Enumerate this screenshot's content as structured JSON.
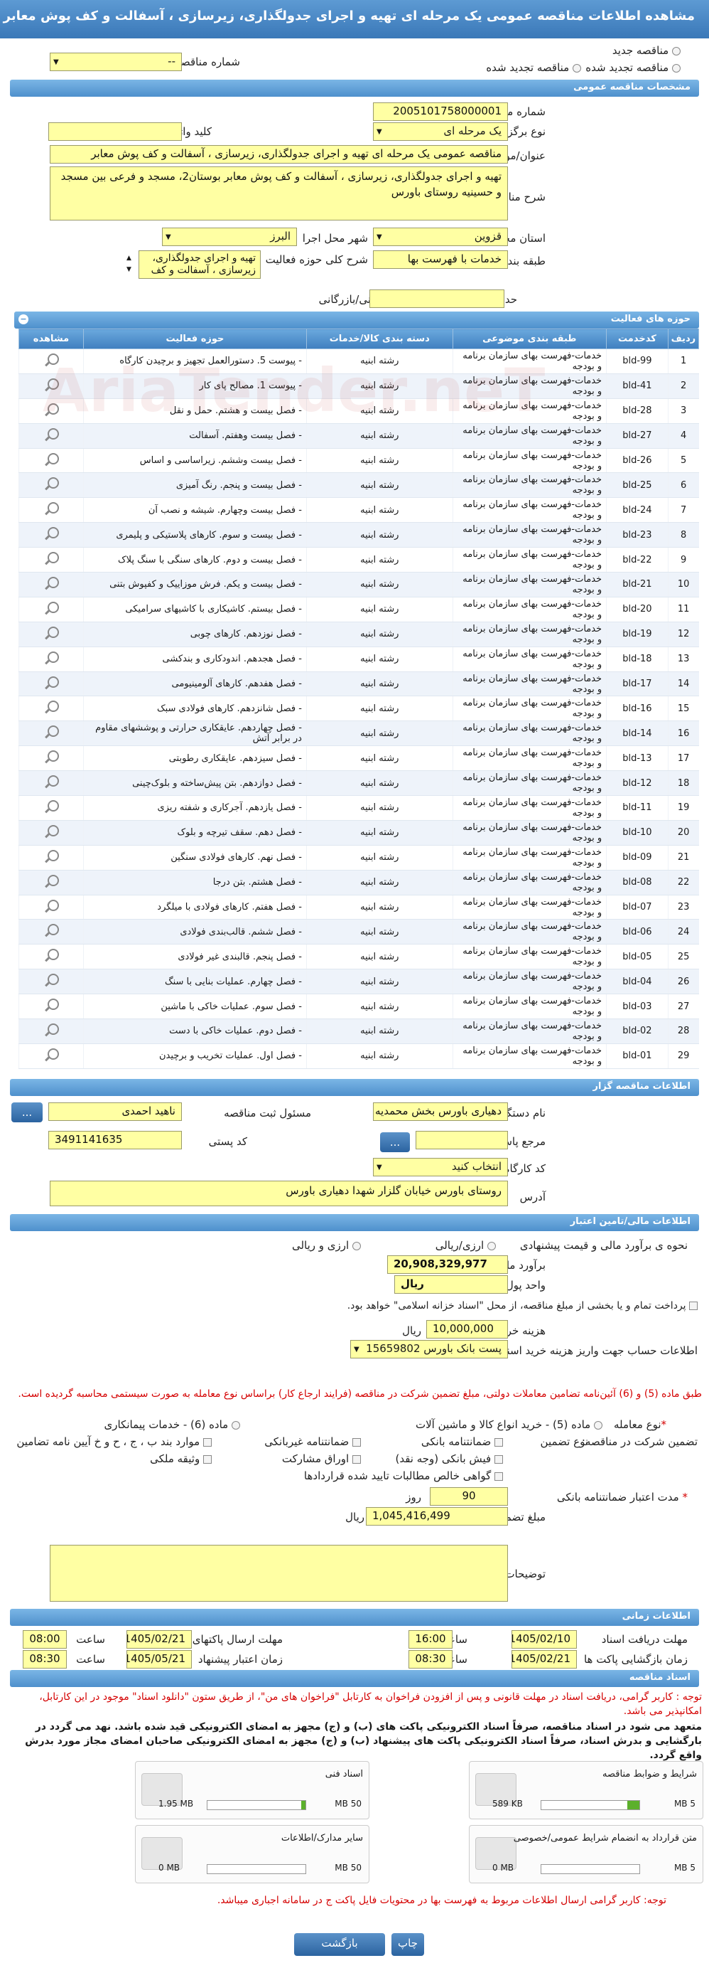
{
  "page_title": "مشاهده اطلاعات مناقصه عمومی یک مرحله ای تهیه و اجرای جدولگذاری، زیرسازی ، آسفالت و کف پوش معابر",
  "top": {
    "new_label": "مناقصه جدید",
    "renewed_label": "مناقصه تجدید شده",
    "renewed2_label": "مناقصه تجدید شده",
    "prev_label": "شماره مناقصه قبلی",
    "prev_value": "--"
  },
  "sections": {
    "general": "مشخصات مناقصه عمومی",
    "activities": "حوزه های فعالیت",
    "organizer": "اطلاعات مناقصه گزار",
    "financial": "اطلاعات مالی/تامین اعتبار",
    "timing": "اطلاعات زمانی",
    "documents": "اسناد مناقصه"
  },
  "general": {
    "tender_no_label": "شماره مناقصه",
    "tender_no": "2005101758000001",
    "type_label": "نوع برگزاری",
    "type": "یک مرحله ای",
    "keyword_label": "کلید واژه",
    "keyword": "",
    "subject_label": "عنوان/موضوع مناقصه",
    "subject": "مناقصه عمومی یک مرحله ای تهیه و اجرای جدولگذاری، زیرسازی ، آسفالت و کف پوش معابر",
    "desc_label": "شرح مناقصه",
    "desc": "تهیه و اجرای جدولگذاری، زیرسازی ، آسفالت و کف پوش معابر بوستان2، مسجد و فرعی بین مسجد و حسینیه روستای باورس",
    "province_label": "استان محل اجرا",
    "province": "قزوین",
    "city_label": "شهر محل اجرا",
    "city": "البرز",
    "category_label": "طبقه بندی موضوعی",
    "category": "خدمات با فهرست بها",
    "activity_label": "شرح کلی حوزه فعالیت",
    "activity": "تهیه و اجرای جدولگذاری، زیرسازی ، آسفالت و کف",
    "min_score_label": "حداقل امتیاز قابل قبول ارزیابی فنی/بازرگانی",
    "min_score": ""
  },
  "grid": {
    "title": "حوزه های فعالیت",
    "headers": [
      "ردیف",
      "کدخدمت",
      "طبقه بندی موضوعی",
      "دسته بندی کالا/خدمات",
      "حوزه فعالیت",
      "مشاهده"
    ],
    "rows": [
      [
        "1",
        "bld-99",
        "خدمات-فهرست بهای سازمان برنامه و بودجه",
        "رشته ابنیه",
        "- پیوست 5. دستورالعمل تجهیز و برچیدن کارگاه"
      ],
      [
        "2",
        "bld-41",
        "خدمات-فهرست بهای سازمان برنامه و بودجه",
        "رشته ابنیه",
        "- پیوست 1. مصالح پای کار"
      ],
      [
        "3",
        "bld-28",
        "خدمات-فهرست بهای سازمان برنامه و بودجه",
        "رشته ابنیه",
        "- فصل بیست و هشتم. حمل و نقل"
      ],
      [
        "4",
        "bld-27",
        "خدمات-فهرست بهای سازمان برنامه و بودجه",
        "رشته ابنیه",
        "- فصل بیست وهفتم. آسفالت"
      ],
      [
        "5",
        "bld-26",
        "خدمات-فهرست بهای سازمان برنامه و بودجه",
        "رشته ابنیه",
        "- فصل بیست وششم. زیراساسی و اساس"
      ],
      [
        "6",
        "bld-25",
        "خدمات-فهرست بهای سازمان برنامه و بودجه",
        "رشته ابنیه",
        "- فصل بیست و پنجم. رنگ آمیزی"
      ],
      [
        "7",
        "bld-24",
        "خدمات-فهرست بهای سازمان برنامه و بودجه",
        "رشته ابنیه",
        "- فصل بیست وچهارم. شیشه و نصب آن"
      ],
      [
        "8",
        "bld-23",
        "خدمات-فهرست بهای سازمان برنامه و بودجه",
        "رشته ابنیه",
        "- فصل بیست و سوم. کارهای پلاستیکی و پلیمری"
      ],
      [
        "9",
        "bld-22",
        "خدمات-فهرست بهای سازمان برنامه و بودجه",
        "رشته ابنیه",
        "- فصل بیست و دوم. کارهای سنگی با سنگ پلاک"
      ],
      [
        "10",
        "bld-21",
        "خدمات-فهرست بهای سازمان برنامه و بودجه",
        "رشته ابنیه",
        "- فصل بیست و یکم. فرش موزاییک و کفپوش بتنی"
      ],
      [
        "11",
        "bld-20",
        "خدمات-فهرست بهای سازمان برنامه و بودجه",
        "رشته ابنیه",
        "- فصل بیستم. کاشیکاری با کاشیهای سرامیکی"
      ],
      [
        "12",
        "bld-19",
        "خدمات-فهرست بهای سازمان برنامه و بودجه",
        "رشته ابنیه",
        "- فصل نوزدهم. کارهای چوبی"
      ],
      [
        "13",
        "bld-18",
        "خدمات-فهرست بهای سازمان برنامه و بودجه",
        "رشته ابنیه",
        "- فصل هجدهم. اندودکاری و بندکشی"
      ],
      [
        "14",
        "bld-17",
        "خدمات-فهرست بهای سازمان برنامه و بودجه",
        "رشته ابنیه",
        "- فصل هفدهم. کارهای آلومینیومی"
      ],
      [
        "15",
        "bld-16",
        "خدمات-فهرست بهای سازمان برنامه و بودجه",
        "رشته ابنیه",
        "- فصل شانزدهم. کارهای فولادی سبک"
      ],
      [
        "16",
        "bld-14",
        "خدمات-فهرست بهای سازمان برنامه و بودجه",
        "رشته ابنیه",
        "- فصل چهاردهم. عایقکاری حرارتی و پوششهای مقاوم در برابر آتش"
      ],
      [
        "17",
        "bld-13",
        "خدمات-فهرست بهای سازمان برنامه و بودجه",
        "رشته ابنیه",
        "- فصل سیزدهم. عایقکاری رطوبتی"
      ],
      [
        "18",
        "bld-12",
        "خدمات-فهرست بهای سازمان برنامه و بودجه",
        "رشته ابنیه",
        "- فصل دوازدهم. بتن پیش‌ساخته و بلوک‌چینی"
      ],
      [
        "19",
        "bld-11",
        "خدمات-فهرست بهای سازمان برنامه و بودجه",
        "رشته ابنیه",
        "- فصل یازدهم. آجرکاری و شفته ریزی"
      ],
      [
        "20",
        "bld-10",
        "خدمات-فهرست بهای سازمان برنامه و بودجه",
        "رشته ابنیه",
        "- فصل دهم. سقف تیرچه و بلوک"
      ],
      [
        "21",
        "bld-09",
        "خدمات-فهرست بهای سازمان برنامه و بودجه",
        "رشته ابنیه",
        "- فصل نهم. کارهای فولادی سنگین"
      ],
      [
        "22",
        "bld-08",
        "خدمات-فهرست بهای سازمان برنامه و بودجه",
        "رشته ابنیه",
        "- فصل هشتم. بتن درجا"
      ],
      [
        "23",
        "bld-07",
        "خدمات-فهرست بهای سازمان برنامه و بودجه",
        "رشته ابنیه",
        "- فصل هفتم. کارهای فولادی با میلگرد"
      ],
      [
        "24",
        "bld-06",
        "خدمات-فهرست بهای سازمان برنامه و بودجه",
        "رشته ابنیه",
        "- فصل ششم. قالب‌بندی فولادی"
      ],
      [
        "25",
        "bld-05",
        "خدمات-فهرست بهای سازمان برنامه و بودجه",
        "رشته ابنیه",
        "- فصل پنجم. قالبندی غیر فولادی"
      ],
      [
        "26",
        "bld-04",
        "خدمات-فهرست بهای سازمان برنامه و بودجه",
        "رشته ابنیه",
        "- فصل چهارم. عملیات بنایی با سنگ"
      ],
      [
        "27",
        "bld-03",
        "خدمات-فهرست بهای سازمان برنامه و بودجه",
        "رشته ابنیه",
        "- فصل سوم. عملیات خاکی با ماشین"
      ],
      [
        "28",
        "bld-02",
        "خدمات-فهرست بهای سازمان برنامه و بودجه",
        "رشته ابنیه",
        "- فصل دوم. عملیات خاکی با دست"
      ],
      [
        "29",
        "bld-01",
        "خدمات-فهرست بهای سازمان برنامه و بودجه",
        "رشته ابنیه",
        "- فصل اول. عملیات تخریب و برچیدن"
      ]
    ]
  },
  "organizer": {
    "org_label": "نام دستگاه اجرایی مناقصه گزار",
    "org": "دهیاری باورس بخش محمدیه",
    "resp_label": "مسئول ثبت مناقصه",
    "resp": "ناهید احمدی",
    "ref_label": "مرجع پاسخگویی",
    "ref": "",
    "postal_label": "کد پستی",
    "postal": "3491141635",
    "workshop_label": "کد کارگاه مناقصه گزار",
    "workshop": "انتخاب کنید",
    "address_label": "آدرس",
    "address": "روستای باورس خیابان گلزار شهدا دهیاری باورس",
    "more": "...",
    "more2": "..."
  },
  "financial": {
    "estimate_label": "نحوه ی برآورد مالی و قیمت پیشنهادی",
    "opt_rial": "ارزی/ریالی",
    "opt_both": "ارزی و ریالی",
    "estimate_amount_label": "برآورد مالی",
    "estimate_amount": "20,908,329,977",
    "currency_label": "واحد پول",
    "currency": "ریال",
    "payment_text": "پرداخت تمام و یا بخشی از مبلغ مناقصه، از محل \"اسناد خزانه اسلامی\" خواهد بود.",
    "doc_fee_label": "هزینه خرید اسناد",
    "doc_fee": "10,000,000",
    "rial": "ریال",
    "account_label": "اطلاعات حساب جهت واریز هزینه خرید اسناد",
    "account": "پست بانک باورس 15659802",
    "article_note": "طبق ماده (5) و (6) آئین‌نامه تضامین معاملات دولتی، مبلغ تضمین شرکت در مناقصه (فرایند ارجاع کار) براساس نوع معامله به صورت سیستمی محاسبه گردیده است.",
    "deal_type_label": "نوع معامله",
    "deal5": "ماده (5) - خرید انواع کالا و ماشین آلات",
    "deal6": "ماده (6) - خدمات پیمانکاری",
    "guarantee_label": "تضمین شرکت در مناقصه:",
    "guarantee_type_label": "نوع تضمین",
    "g1": "ضمانتنامه بانکی",
    "g2": "ضمانتنامه غیربانکی",
    "g3": "موارد بند ب ، ج ، ح و خ آیین نامه تضامین",
    "g4": "فیش بانکی (وجه نقد)",
    "g5": "اوراق مشارکت",
    "g6": "وثیقه ملکی",
    "g7": "گواهی خالص مطالبات تایید شده قراردادها",
    "validity_label": "مدت اعتبار ضمانتنامه بانکی",
    "validity": "90",
    "day": "روز",
    "guarantee_amount_label": "مبلغ تضمین",
    "guarantee_amount": "1,045,416,499",
    "notes_label": "توضیحات"
  },
  "timing": {
    "doc_receive_label": "مهلت دریافت اسناد",
    "doc_receive_date": "1405/02/10",
    "doc_receive_time": "16:00",
    "time_label": "ساعت",
    "send_label": "مهلت ارسال پاکتهای پیشنهاد",
    "send_date": "1405/02/21",
    "send_time": "08:00",
    "open_label": "زمان بازگشایی پاکت ها",
    "open_date": "1405/02/21",
    "open_time": "08:30",
    "validity_label": "زمان اعتبار پیشنهاد",
    "validity_date": "1405/05/21",
    "validity_time": "08:30"
  },
  "documents": {
    "note1": "توجه : کاربر گرامی، دریافت اسناد در مهلت قانونی و پس از افزودن فراخوان به کارتابل \"فراخوان های من\"، از طریق ستون \"دانلود اسناد\" موجود در این کارتابل، امکانپذیر می باشد.",
    "note2": "متعهد می شود در اسناد مناقصه، صرفاً اسناد الکترونیکی پاکت های (ب) و (ج) مجهز به امضای الکترونیکی قید شده باشد. نهد می گردد در بارگشایی و بدرش اسناد، صرفاً اسناد الکترونیکی پاکت های پیشنهاد (ب) و (ج) مجهز به امضای الکترونیکی صاحبان امضای مجاز مورد بدرش واقع گردد.",
    "files": [
      {
        "name": "شرایط و ضوابط مناقصه",
        "size": "589 KB",
        "limit": "5 MB",
        "fill": 0.12
      },
      {
        "name": "اسناد فنی",
        "size": "1.95 MB",
        "limit": "50 MB",
        "fill": 0.04
      },
      {
        "name": "متن قرارداد به انضمام شرایط عمومی/خصوصی",
        "size": "0 MB",
        "limit": "5 MB",
        "fill": 0
      },
      {
        "name": "سایر مدارک/اطلاعات",
        "size": "0 MB",
        "limit": "50 MB",
        "fill": 0
      }
    ],
    "note3": "توجه: کاربر گرامی ارسال اطلاعات مربوط به فهرست بها در محتویات فایل پاکت ج در سامانه اجباری میباشد.",
    "print": "چاپ",
    "back": "بازگشت"
  },
  "watermark": "AriaTender.neT",
  "colors": {
    "accent": "#4e90cc",
    "field": "#ffffa3",
    "note": "#d40000"
  }
}
